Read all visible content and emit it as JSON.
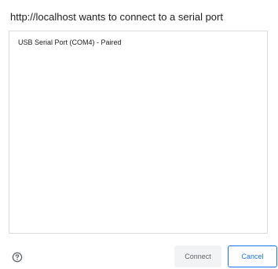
{
  "dialog": {
    "title": "http://localhost wants to connect to a serial port",
    "ports": [
      {
        "label": "USB Serial Port (COM4) - Paired"
      }
    ],
    "help_icon": "question-circle-icon",
    "connect_label": "Connect",
    "cancel_label": "Cancel"
  },
  "colors": {
    "accent": "#1a73e8",
    "border": "#dadce0",
    "disabled_bg": "#f1f3f4",
    "disabled_text": "#5f6368",
    "text": "#202124"
  }
}
